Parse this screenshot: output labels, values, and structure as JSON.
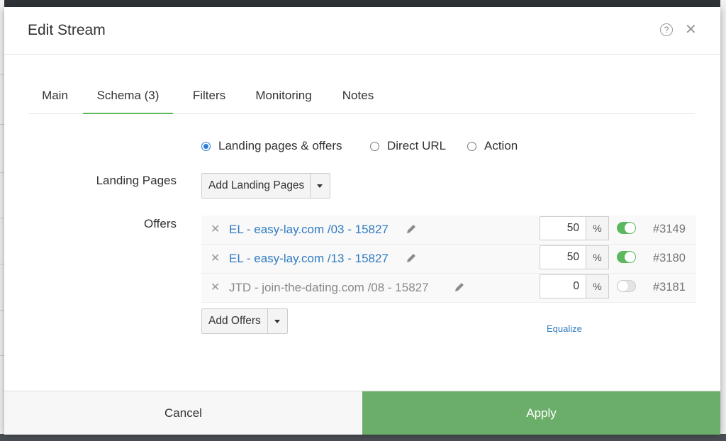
{
  "modal": {
    "title": "Edit Stream",
    "help_icon": "question-circle-icon",
    "close_icon": "close-icon"
  },
  "tabs": [
    {
      "label": "Main",
      "active": false
    },
    {
      "label": "Schema (3)",
      "active": true
    },
    {
      "label": "Filters",
      "active": false
    },
    {
      "label": "Monitoring",
      "active": false
    },
    {
      "label": "Notes",
      "active": false
    }
  ],
  "schema": {
    "options": [
      {
        "label": "Landing pages & offers",
        "selected": true
      },
      {
        "label": "Direct URL",
        "selected": false
      },
      {
        "label": "Action",
        "selected": false
      }
    ]
  },
  "landing_pages": {
    "label": "Landing Pages",
    "add_button": "Add Landing Pages"
  },
  "offers": {
    "label": "Offers",
    "rows": [
      {
        "name": "EL - easy-lay.com /03 - 15827",
        "share": "50",
        "unit": "%",
        "enabled": true,
        "id": "#3149"
      },
      {
        "name": "EL - easy-lay.com /13 - 15827",
        "share": "50",
        "unit": "%",
        "enabled": true,
        "id": "#3180"
      },
      {
        "name": "JTD - join-the-dating.com /08 - 15827",
        "share": "0",
        "unit": "%",
        "enabled": false,
        "id": "#3181"
      }
    ],
    "add_button": "Add Offers",
    "equalize": "Equalize"
  },
  "footer": {
    "cancel": "Cancel",
    "apply": "Apply"
  },
  "colors": {
    "accent_green": "#5cb85c",
    "apply_green": "#6aae6a",
    "link_blue": "#2f7bc1",
    "radio_blue": "#2a7bd5"
  }
}
